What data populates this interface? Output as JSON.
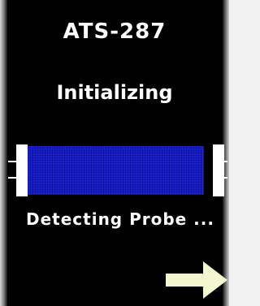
{
  "device": {
    "title": "ATS-287",
    "status": "Initializing",
    "message": "Detecting Probe ..."
  },
  "progress": {
    "fraction": 0.95,
    "fill_color": "#1a1fd6",
    "cap_color": "#ffffff"
  },
  "navigation": {
    "next_icon": "arrow-right-icon",
    "arrow_color": "#f4f6d0"
  }
}
